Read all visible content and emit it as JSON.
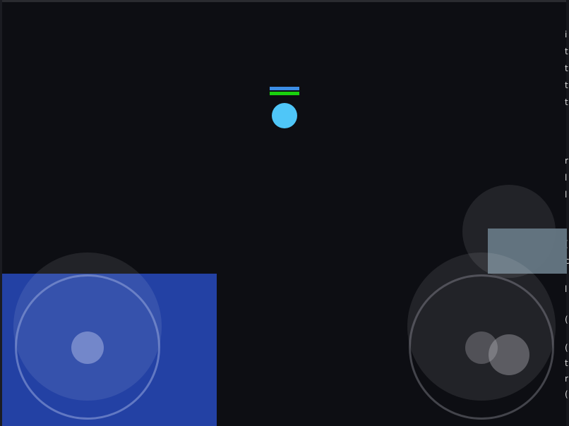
{
  "colors": {
    "background": "#0d0e13",
    "player": "#4fc6f8",
    "shield_bar": "#3c8ee6",
    "health_bar": "#19d10d",
    "move_zone": "#2341a4",
    "skill_panel": "#667884"
  },
  "player": {
    "shield": 1.0,
    "health": 1.0
  },
  "sidebar_glyphs": [
    "i",
    "t",
    "t",
    "t",
    "t",
    "r",
    "l",
    "l",
    "(",
    "c",
    "l",
    "(",
    "(",
    "t",
    "r",
    "("
  ]
}
